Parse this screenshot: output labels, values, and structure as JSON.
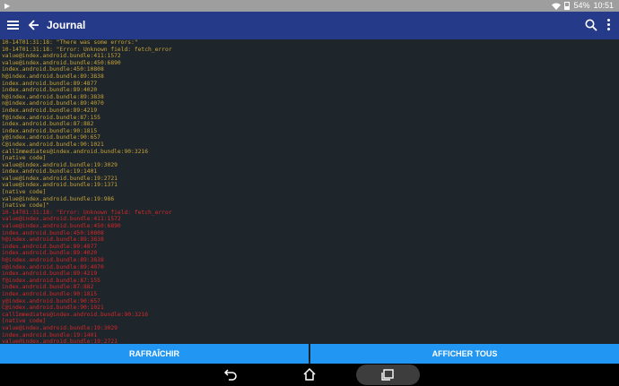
{
  "status_bar": {
    "play_icon": "play-store-icon",
    "battery": "54%",
    "time": "10:51"
  },
  "app_bar": {
    "title": "Journal"
  },
  "log": {
    "lines": [
      {
        "level": "warn",
        "text": "10-14T01:31:18: \"There was some errors:\""
      },
      {
        "level": "warn",
        "text": "10-14T01:31:18: \"Error: Unknown field: fetch_error"
      },
      {
        "level": "warn",
        "text": "value@index.android.bundle:411:1572"
      },
      {
        "level": "warn",
        "text": "value@index.android.bundle:450:6890"
      },
      {
        "level": "warn",
        "text": "index.android.bundle:450:10808"
      },
      {
        "level": "warn",
        "text": "h@index.android.bundle:89:3838"
      },
      {
        "level": "warn",
        "text": "index.android.bundle:89:4877"
      },
      {
        "level": "warn",
        "text": "index.android.bundle:89:4020"
      },
      {
        "level": "warn",
        "text": "h@index.android.bundle:89:3838"
      },
      {
        "level": "warn",
        "text": "n@index.android.bundle:89:4070"
      },
      {
        "level": "warn",
        "text": "index.android.bundle:89:4219"
      },
      {
        "level": "warn",
        "text": "f@index.android.bundle:87:155"
      },
      {
        "level": "warn",
        "text": "index.android.bundle:87:882"
      },
      {
        "level": "warn",
        "text": "index.android.bundle:90:1815"
      },
      {
        "level": "warn",
        "text": "y@index.android.bundle:90:657"
      },
      {
        "level": "warn",
        "text": "C@index.android.bundle:90:1021"
      },
      {
        "level": "warn",
        "text": "callImmediates@index.android.bundle:90:3216"
      },
      {
        "level": "warn",
        "text": "[native code]"
      },
      {
        "level": "warn",
        "text": "value@index.android.bundle:19:3029"
      },
      {
        "level": "warn",
        "text": "index.android.bundle:19:1401"
      },
      {
        "level": "warn",
        "text": "value@index.android.bundle:19:2721"
      },
      {
        "level": "warn",
        "text": "value@index.android.bundle:19:1371"
      },
      {
        "level": "warn",
        "text": "[native code]"
      },
      {
        "level": "warn",
        "text": "value@index.android.bundle:19:986"
      },
      {
        "level": "warn",
        "text": "[native code]\""
      },
      {
        "level": "error",
        "text": "10-14T01:31:18: \"Error: Unknown field: fetch_error"
      },
      {
        "level": "error",
        "text": "value@index.android.bundle:411:1572"
      },
      {
        "level": "error",
        "text": "value@index.android.bundle:450:6890"
      },
      {
        "level": "error",
        "text": "index.android.bundle:450:10808"
      },
      {
        "level": "error",
        "text": "h@index.android.bundle:89:3838"
      },
      {
        "level": "error",
        "text": "index.android.bundle:89:4877"
      },
      {
        "level": "error",
        "text": "index.android.bundle:89:4020"
      },
      {
        "level": "error",
        "text": "h@index.android.bundle:89:3838"
      },
      {
        "level": "error",
        "text": "n@index.android.bundle:89:4070"
      },
      {
        "level": "error",
        "text": "index.android.bundle:89:4219"
      },
      {
        "level": "error",
        "text": "f@index.android.bundle:87:155"
      },
      {
        "level": "error",
        "text": "index.android.bundle:87:882"
      },
      {
        "level": "error",
        "text": "index.android.bundle:90:1815"
      },
      {
        "level": "error",
        "text": "y@index.android.bundle:90:657"
      },
      {
        "level": "error",
        "text": "C@index.android.bundle:90:1021"
      },
      {
        "level": "error",
        "text": "callImmediates@index.android.bundle:90:3216"
      },
      {
        "level": "error",
        "text": "[native code]"
      },
      {
        "level": "error",
        "text": "value@index.android.bundle:19:3029"
      },
      {
        "level": "error",
        "text": "index.android.bundle:19:1401"
      },
      {
        "level": "error",
        "text": "value@index.android.bundle:19:2721"
      }
    ]
  },
  "buttons": {
    "refresh_label": "RAFRAÎCHIR",
    "show_all_label": "AFFICHER TOUS"
  },
  "colors": {
    "app_bar": "#263a8a",
    "button": "#2196f3",
    "log_background": "#1e252b",
    "warn_text": "#c8a53b",
    "error_text": "#d42a2a"
  }
}
